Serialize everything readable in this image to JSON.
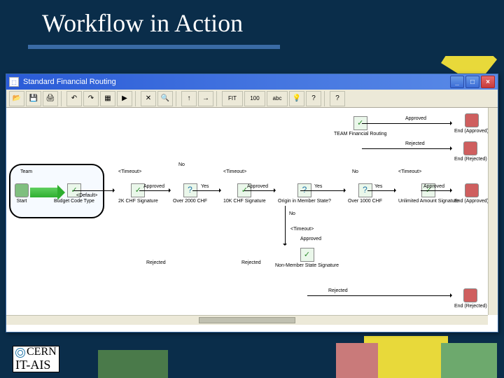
{
  "slide": {
    "title": "Workflow in Action"
  },
  "window": {
    "title": "Standard Financial Routing",
    "buttons": {
      "min": "_",
      "max": "□",
      "close": "×"
    }
  },
  "toolbar": {
    "btn_open": "📂",
    "btn_save": "💾",
    "btn_print": "🖨",
    "btn_undo": "↶",
    "btn_redo": "↷",
    "btn_grid": "▦",
    "btn_run": "▶",
    "btn_del": "✕",
    "btn_zoom": "🔍",
    "btn_up": "↑",
    "btn_fwd": "→",
    "btn_fit": "FIT",
    "btn_100": "100",
    "btn_abc": "abc",
    "btn_bulb": "💡",
    "btn_q": "?",
    "btn_help": "?"
  },
  "nodes": {
    "start": "Start",
    "budget": "Budget Code Type",
    "sig2k": "2K CHF Signature",
    "over2k": "Over 2000 CHF",
    "sig10k": "10K CHF Signature",
    "originms": "Origin in Member State?",
    "nms_sig": "Non-Member State Signature",
    "over1000": "Over 1000 CHF",
    "unlim": "Unlimited Amount Signature",
    "team": "Team",
    "teamfin": "TEAM Financial Routing",
    "end_app1": "End (Approved)",
    "end_rej1": "End (Rejected)",
    "end_app2": "End (Approved)",
    "end_rej2": "End (Rejected)"
  },
  "edges": {
    "default": "<Default>",
    "timeout": "<Timeout>",
    "approved": "Approved",
    "rejected": "Rejected",
    "yes": "Yes",
    "no": "No"
  },
  "footer": {
    "line1": "CERN",
    "line2": "IT-AIS"
  }
}
